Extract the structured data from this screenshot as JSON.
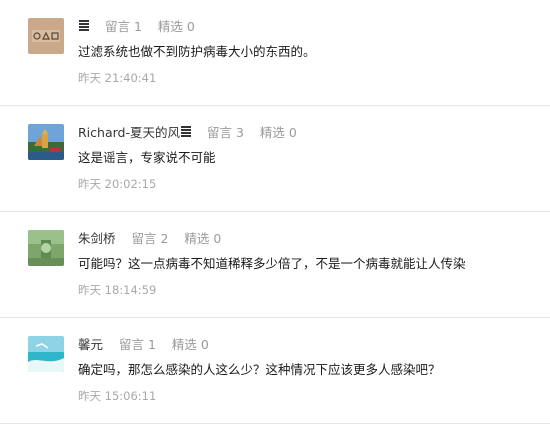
{
  "comments": [
    {
      "nickname": "",
      "replies_label": "留言 1",
      "featured_label": "精选 0",
      "text": "过滤系统也做不到防护病毒大小的东西的。",
      "time": "昨天 21:40:41",
      "avatar_logo_text": "OAO"
    },
    {
      "nickname": "Richard-夏天的风",
      "replies_label": "留言 3",
      "featured_label": "精选 0",
      "text": "这是谣言，专家说不可能",
      "time": "昨天 20:02:15"
    },
    {
      "nickname": "朱剑桥",
      "replies_label": "留言 2",
      "featured_label": "精选 0",
      "text": "可能吗？这一点病毒不知道稀释多少倍了，不是一个病毒就能让人传染",
      "time": "昨天 18:14:59"
    },
    {
      "nickname": "馨元",
      "replies_label": "留言 1",
      "featured_label": "精选 0",
      "text": "确定吗，那怎么感染的人这么少？这种情况下应该更多人感染吧？",
      "time": "昨天 15:06:11"
    }
  ]
}
